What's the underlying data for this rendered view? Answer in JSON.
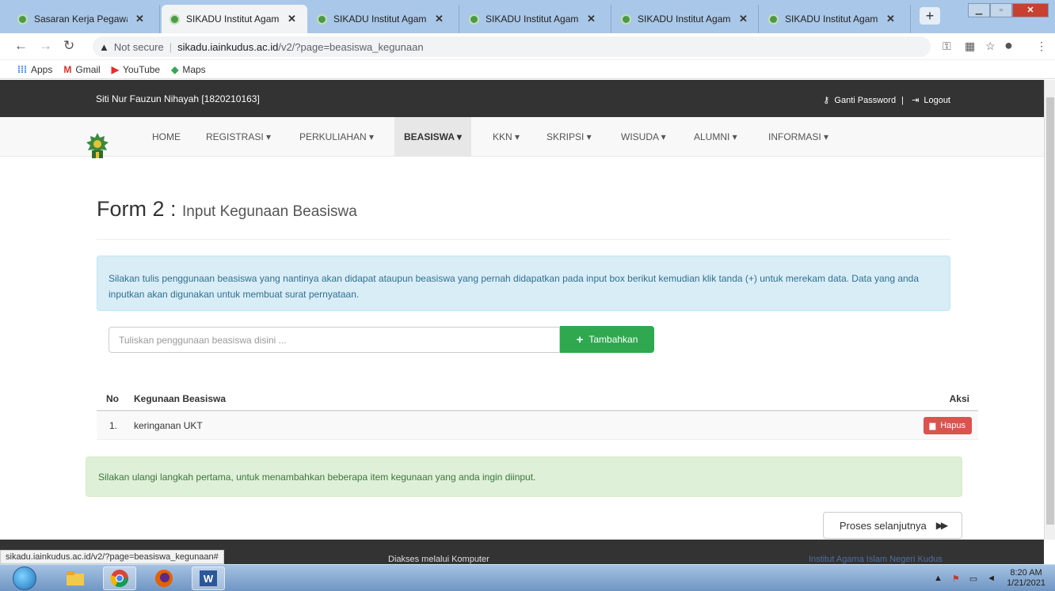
{
  "browser": {
    "tabs": [
      {
        "label": "Sasaran Kerja Pegawai -",
        "active": false
      },
      {
        "label": "SIKADU Institut Agama I",
        "active": true
      },
      {
        "label": "SIKADU Institut Agama I",
        "active": false
      },
      {
        "label": "SIKADU Institut Agama I",
        "active": false
      },
      {
        "label": "SIKADU Institut Agama I",
        "active": false
      },
      {
        "label": "SIKADU Institut Agama I",
        "active": false
      }
    ],
    "tab_close": "✕",
    "new_tab": "+",
    "security_label": "Not secure",
    "url_host": "sikadu.iainkudus.ac.id",
    "url_path": "/v2/?page=beasiswa_kegunaan",
    "bookmarks": [
      {
        "icon": "apps-grid-icon",
        "label": "Apps"
      },
      {
        "icon": "gmail-icon",
        "label": "Gmail"
      },
      {
        "icon": "youtube-icon",
        "label": "YouTube"
      },
      {
        "icon": "maps-icon",
        "label": "Maps"
      }
    ],
    "status_url": "sikadu.iainkudus.ac.id/v2/?page=beasiswa_kegunaan#"
  },
  "topbar": {
    "user": "Siti Nur Fauzun Nihayah [1820210163]",
    "change_password": "Ganti Password",
    "separator": "|",
    "logout": "Logout"
  },
  "nav": {
    "items": [
      {
        "label": "HOME",
        "active": false
      },
      {
        "label": "REGISTRASI ▾",
        "active": false
      },
      {
        "label": "PERKULIAHAN ▾",
        "active": false
      },
      {
        "label": "BEASISWA ▾",
        "active": true
      },
      {
        "label": "KKN ▾",
        "active": false
      },
      {
        "label": "SKRIPSI ▾",
        "active": false
      },
      {
        "label": "WISUDA ▾",
        "active": false
      },
      {
        "label": "ALUMNI ▾",
        "active": false
      },
      {
        "label": "INFORMASI ▾",
        "active": false
      }
    ]
  },
  "form": {
    "title": "Form 2 :",
    "subtitle": "Input Kegunaan Beasiswa",
    "info": "Silakan tulis penggunaan beasiswa yang nantinya akan didapat ataupun beasiswa yang pernah didapatkan pada input box berikut kemudian klik tanda (+) untuk merekam data. Data yang anda inputkan akan digunakan untuk membuat surat pernyataan.",
    "input_placeholder": "Tuliskan penggunaan beasiswa disini ...",
    "add_label": "Tambahkan"
  },
  "table": {
    "headers": {
      "no": "No",
      "usage": "Kegunaan Beasiswa",
      "action": "Aksi"
    },
    "rows": [
      {
        "no": "1.",
        "usage": "keringanan UKT",
        "action": "Hapus"
      }
    ]
  },
  "success_note": "Silakan ulangi langkah pertama, untuk menambahkan beberapa item kegunaan yang anda ingin diinput.",
  "next_label": "Proses selanjutnya",
  "footer": {
    "access": "Diakses melalui Komputer",
    "institution": "Institut Agama Islam Negeri Kudus"
  },
  "taskbar": {
    "time": "8:20 AM",
    "date": "1/21/2021"
  },
  "colors": {
    "topbar": "#333333",
    "success_button": "#2fa84f",
    "danger_button": "#d9534f",
    "info_bg": "#d9edf7",
    "success_bg": "#dff0d8"
  }
}
